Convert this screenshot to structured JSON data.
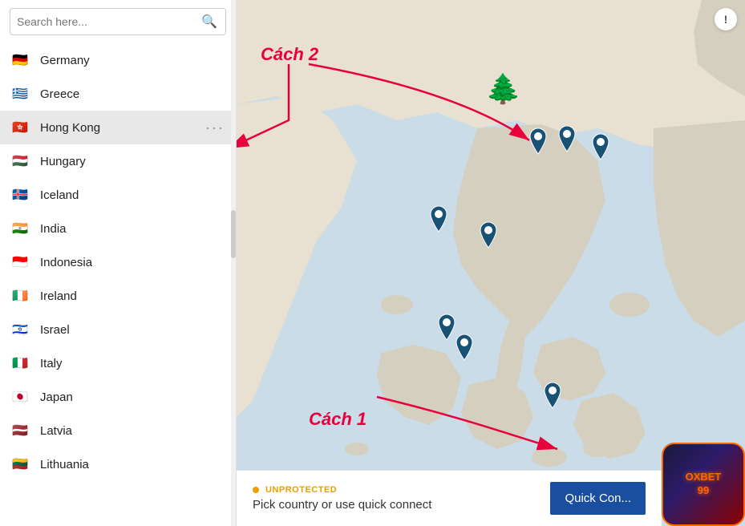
{
  "search": {
    "placeholder": "Search here...",
    "value": ""
  },
  "countries": [
    {
      "id": "germany",
      "name": "Germany",
      "flag": "🇩🇪",
      "active": false
    },
    {
      "id": "greece",
      "name": "Greece",
      "flag": "🇬🇷",
      "active": false
    },
    {
      "id": "hong-kong",
      "name": "Hong Kong",
      "flag": "🇭🇰",
      "active": true
    },
    {
      "id": "hungary",
      "name": "Hungary",
      "flag": "🇭🇺",
      "active": false
    },
    {
      "id": "iceland",
      "name": "Iceland",
      "flag": "🇮🇸",
      "active": false
    },
    {
      "id": "india",
      "name": "India",
      "flag": "🇮🇳",
      "active": false
    },
    {
      "id": "indonesia",
      "name": "Indonesia",
      "flag": "🇮🇩",
      "active": false
    },
    {
      "id": "ireland",
      "name": "Ireland",
      "flag": "🇮🇪",
      "active": false
    },
    {
      "id": "israel",
      "name": "Israel",
      "flag": "🇮🇱",
      "active": false
    },
    {
      "id": "italy",
      "name": "Italy",
      "flag": "🇮🇹",
      "active": false
    },
    {
      "id": "japan",
      "name": "Japan",
      "flag": "🇯🇵",
      "active": false
    },
    {
      "id": "latvia",
      "name": "Latvia",
      "flag": "🇱🇻",
      "active": false
    },
    {
      "id": "lithuania",
      "name": "Lithuania",
      "flag": "🇱🇹",
      "active": false
    }
  ],
  "annotations": {
    "cach2": "Cách 2",
    "cach1": "Cách 1"
  },
  "bottomBar": {
    "statusLabel": "UNPROTECTED",
    "pickText": "Pick country or use quick connect",
    "quickConnectLabel": "Quick Con..."
  },
  "oxbet": {
    "line1": "OXBET",
    "line2": "99"
  },
  "infoBtnLabel": "ⓘ",
  "moreDots": "···"
}
